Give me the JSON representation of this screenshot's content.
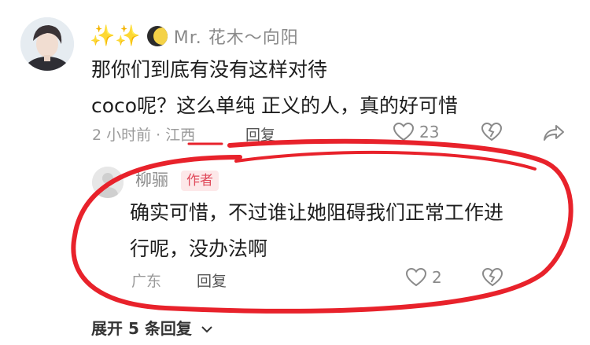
{
  "comment": {
    "author_decoration": "✨✨",
    "author_name": "Mr. 花木～向阳",
    "text_line1": "那你们到底有没有这样对待",
    "text_line2": "coco呢？这么单纯 正义的人，真的好可惜",
    "time_location": "2 小时前 · 江西",
    "reply_label": "回复",
    "like_count": "23"
  },
  "reply": {
    "author_name": "柳骊",
    "badge": "作者",
    "text_line1": "确实可惜，不过谁让她阻碍我们正常工作进",
    "text_line2": "行呢，没办法啊",
    "location": "广东",
    "reply_label": "回复",
    "like_count": "2"
  },
  "expand_label": "展开 5 条回复",
  "colors": {
    "annotation_red": "#e8222b",
    "meta_gray": "#9a9a9a",
    "badge_bg": "#fde8e9",
    "badge_text": "#e04a5b"
  },
  "icons": [
    "sparkles-icon",
    "moon-icon",
    "heart-icon",
    "heart-broken-icon",
    "share-icon",
    "chevron-down-icon"
  ]
}
